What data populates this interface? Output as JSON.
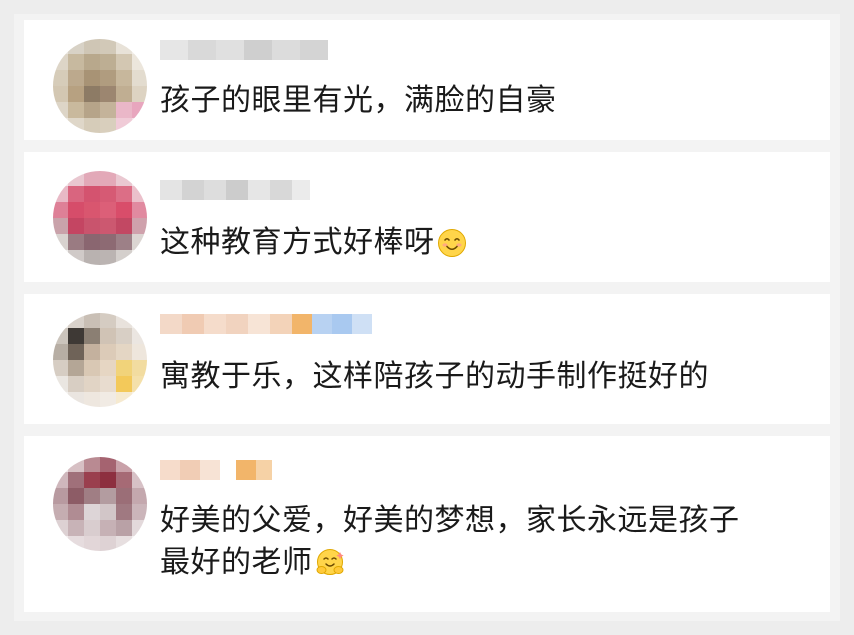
{
  "comments": [
    {
      "text": "孩子的眼里有光，满脸的自豪"
    },
    {
      "text": "这种教育方式好棒呀",
      "emoji": "smiling-face-emoji"
    },
    {
      "text": "寓教于乐，这样陪孩子的动手制作挺好的"
    },
    {
      "text_line1": "好美的父爱，好美的梦想，家长永远是孩子",
      "text_line2": "最好的老师",
      "emoji": "hug-face-emoji"
    }
  ]
}
